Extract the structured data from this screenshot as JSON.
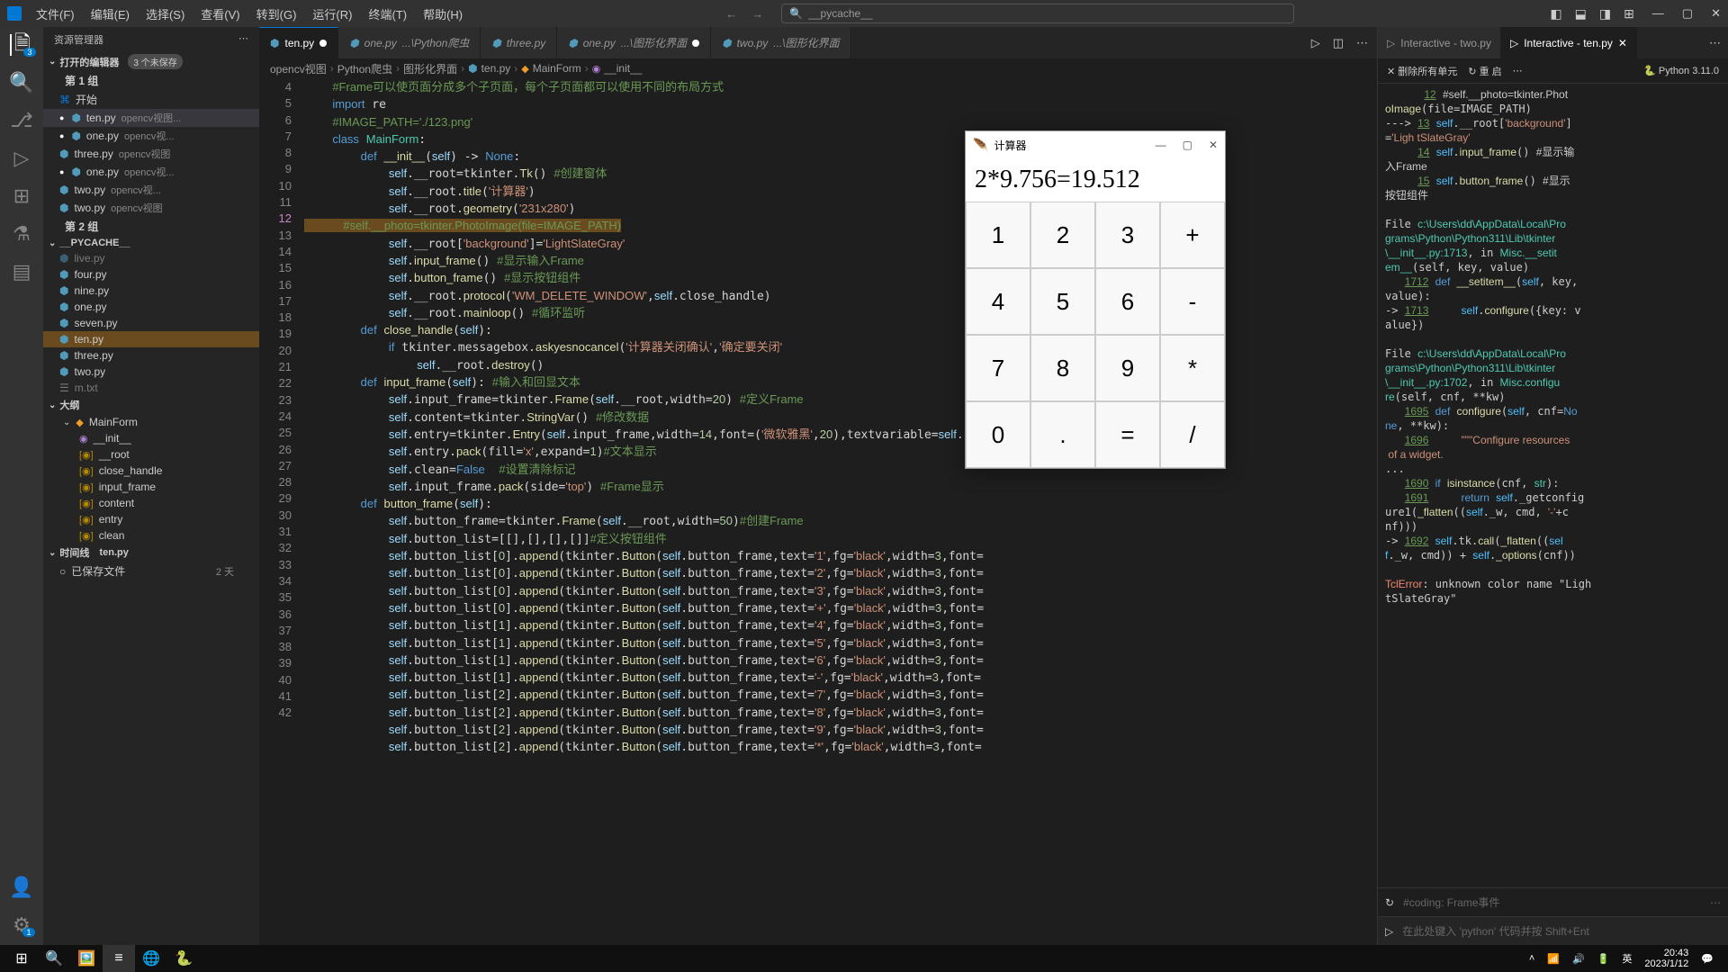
{
  "titlebar": {
    "menus": [
      "文件(F)",
      "编辑(E)",
      "选择(S)",
      "查看(V)",
      "转到(G)",
      "运行(R)",
      "终端(T)",
      "帮助(H)"
    ],
    "search_prefix": "__pycache__"
  },
  "sidebar": {
    "title": "资源管理器",
    "open_editors": "打开的编辑器",
    "unsaved_badge": "3 个未保存",
    "group1": "第 1 组",
    "group2": "第 2 组",
    "welcome": "开始",
    "files1": [
      {
        "name": "ten.py",
        "dim": "opencv视图...",
        "mod": true
      },
      {
        "name": "one.py",
        "dim": "opencv视...",
        "mod": true
      },
      {
        "name": "three.py",
        "dim": "opencv视图"
      },
      {
        "name": "one.py",
        "dim": "opencv视...",
        "mod": true
      },
      {
        "name": "two.py",
        "dim": "opencv视..."
      },
      {
        "name": "two.py",
        "dim": "opencv视图"
      }
    ],
    "folder_pycache": "__PYCACHE__",
    "pycache_files": [
      "live.py",
      "four.py",
      "nine.py",
      "one.py",
      "seven.py",
      "ten.py",
      "three.py",
      "two.py",
      "m.txt"
    ],
    "outline": "大纲",
    "class": "MainForm",
    "methods": [
      "__init__",
      "__root",
      "close_handle",
      "input_frame",
      "content",
      "entry",
      "clean"
    ],
    "timeline": "时间线",
    "timeline_file": "ten.py",
    "saved_file": "已保存文件",
    "saved_time": "2 天"
  },
  "tabs": [
    {
      "label": "ten.py",
      "active": true,
      "mod": true
    },
    {
      "label": "one.py",
      "dim": "...\\Python爬虫"
    },
    {
      "label": "three.py"
    },
    {
      "label": "one.py",
      "dim": "...\\图形化界面",
      "mod": true
    },
    {
      "label": "two.py",
      "dim": "...\\图形化界面"
    }
  ],
  "breadcrumb": [
    "opencv视图",
    "Python爬虫",
    "图形化界面",
    "ten.py",
    "MainForm",
    "__init__"
  ],
  "lines": {
    "start": 4,
    "end": 42
  },
  "interactive_tabs": [
    {
      "label": "Interactive - two.py"
    },
    {
      "label": "Interactive - ten.py",
      "active": true
    }
  ],
  "interactive": {
    "clear_all": "删除所有单元",
    "restart": "重 启",
    "python": "Python 3.11.0"
  },
  "repl_input": "#coding: Frame事件",
  "run_placeholder": "在此处键入 'python' 代码并按 Shift+Ent",
  "calculator": {
    "title": "计算器",
    "display": "2*9.756=19.512",
    "buttons": [
      "1",
      "2",
      "3",
      "+",
      "4",
      "5",
      "6",
      "-",
      "7",
      "8",
      "9",
      "*",
      "0",
      ".",
      "=",
      "/"
    ]
  },
  "taskbar": {
    "time": "20:43",
    "date": "2023/1/12",
    "ime": "英"
  }
}
